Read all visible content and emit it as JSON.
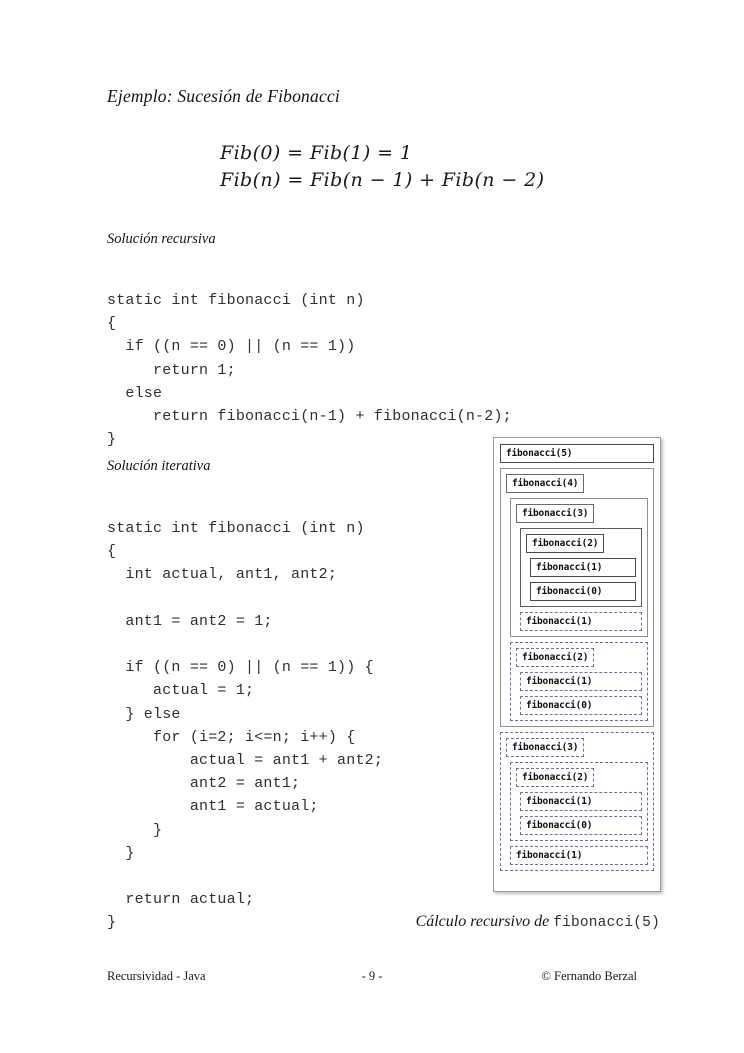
{
  "document": {
    "title": "Ejemplo: Sucesión de Fibonacci"
  },
  "formula": {
    "line1": "Fib(0) = Fib(1) = 1",
    "line2": "Fib(n) = Fib(n − 1) + Fib(n − 2)"
  },
  "sections": {
    "recursive_heading": "Solución recursiva",
    "iterative_heading": "Solución iterativa"
  },
  "code": {
    "recursive": "static int fibonacci (int n)\n{\n  if ((n == 0) || (n == 1))\n     return 1;\n  else\n     return fibonacci(n-1) + fibonacci(n-2);\n}",
    "iterative": "static int fibonacci (int n)\n{\n  int actual, ant1, ant2;\n\n  ant1 = ant2 = 1;\n\n  if ((n == 0) || (n == 1)) {\n     actual = 1;\n  } else\n     for (i=2; i<=n; i++) {\n         actual = ant1 + ant2;\n         ant2 = ant1;\n         ant1 = actual;\n     }\n  }\n\n  return actual;\n}"
  },
  "diagram": {
    "root_label": "fibonacci(5)",
    "f4_label": "fibonacci(4)",
    "f3a_label": "fibonacci(3)",
    "f2a_label": "fibonacci(2)",
    "f1a_label": "fibonacci(1)",
    "f0a_label": "fibonacci(0)",
    "f1b_label": "fibonacci(1)",
    "f2b_label": "fibonacci(2)",
    "f1c_label": "fibonacci(1)",
    "f0b_label": "fibonacci(0)",
    "f3b_label": "fibonacci(3)",
    "f2c_label": "fibonacci(2)",
    "f1d_label": "fibonacci(1)",
    "f0c_label": "fibonacci(0)",
    "f1e_label": "fibonacci(1)",
    "colors": {
      "solid_border": "#4a4a4a",
      "frame_border": "#8f8f8f",
      "dashed_border": "#6b6fa8",
      "outer_border": "#9a9a9a"
    }
  },
  "caption": {
    "italic_part": "Cálculo recursivo de ",
    "mono_part": "fibonacci(5)"
  },
  "footer": {
    "left": "Recursividad - Java",
    "center": "- 9 -",
    "right": "© Fernando Berzal"
  }
}
